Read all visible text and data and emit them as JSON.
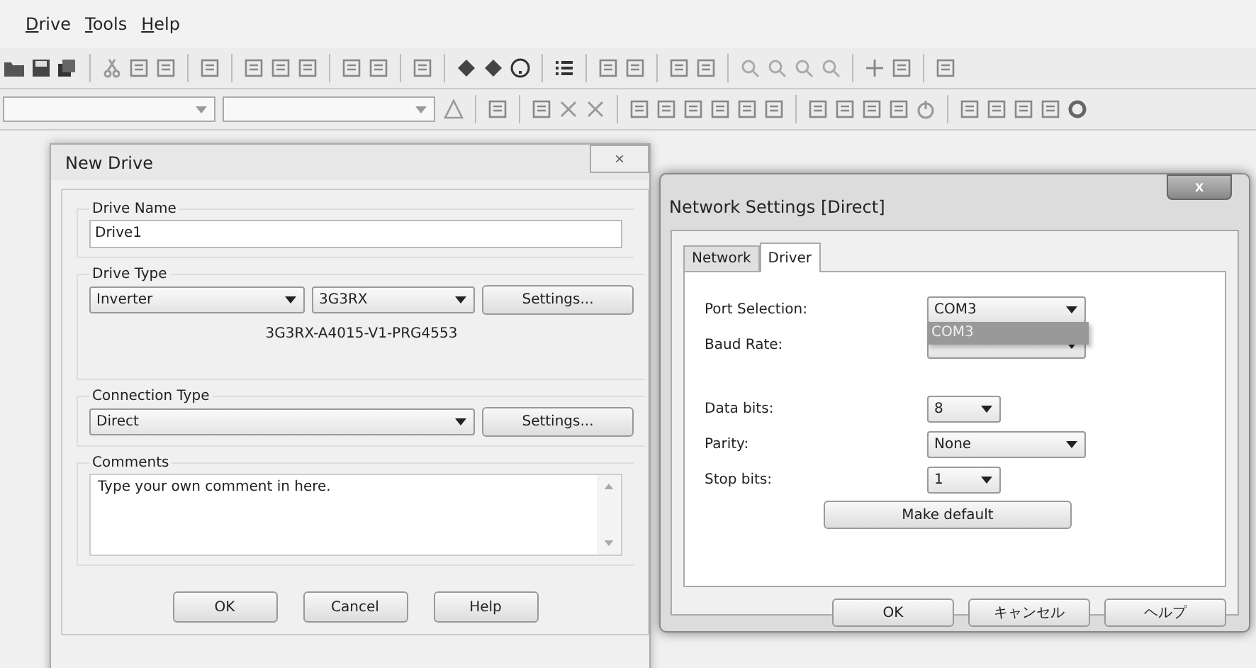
{
  "menu_bar": [
    "Drive",
    "Tools",
    "Help"
  ],
  "new_drive_dialog": {
    "title": "New Drive",
    "close": "×",
    "drive_name": {
      "label": "Drive Name",
      "value": "Drive1"
    },
    "drive_type": {
      "label": "Drive Type",
      "type": "Inverter",
      "model": "3G3RX",
      "settings": "Settings...",
      "description": "3G3RX-A4015-V1-PRG4553"
    },
    "connection_type": {
      "label": "Connection Type",
      "value": "Direct",
      "settings": "Settings..."
    },
    "comments": {
      "label": "Comments",
      "value": "Type your own comment in here."
    },
    "buttons": [
      "OK",
      "Cancel",
      "Help"
    ]
  },
  "network_dialog": {
    "title": "Network Settings [Direct]",
    "close": "x",
    "tabs": [
      {
        "label": "Network",
        "selected": false
      },
      {
        "label": "Driver",
        "selected": true
      }
    ],
    "fields": [
      {
        "label": "Port Selection:",
        "value": "COM3"
      },
      {
        "label": "Baud Rate:"
      },
      {
        "label": "Data bits:",
        "value": "8"
      },
      {
        "label": "Parity:",
        "value": "None"
      },
      {
        "label": "Stop bits:",
        "value": "1"
      }
    ],
    "open_list": [
      {
        "label": "COM3",
        "selected": true
      }
    ],
    "make_default": "Make default",
    "buttons": [
      "OK",
      "キャンセル",
      "ヘルプ"
    ]
  }
}
